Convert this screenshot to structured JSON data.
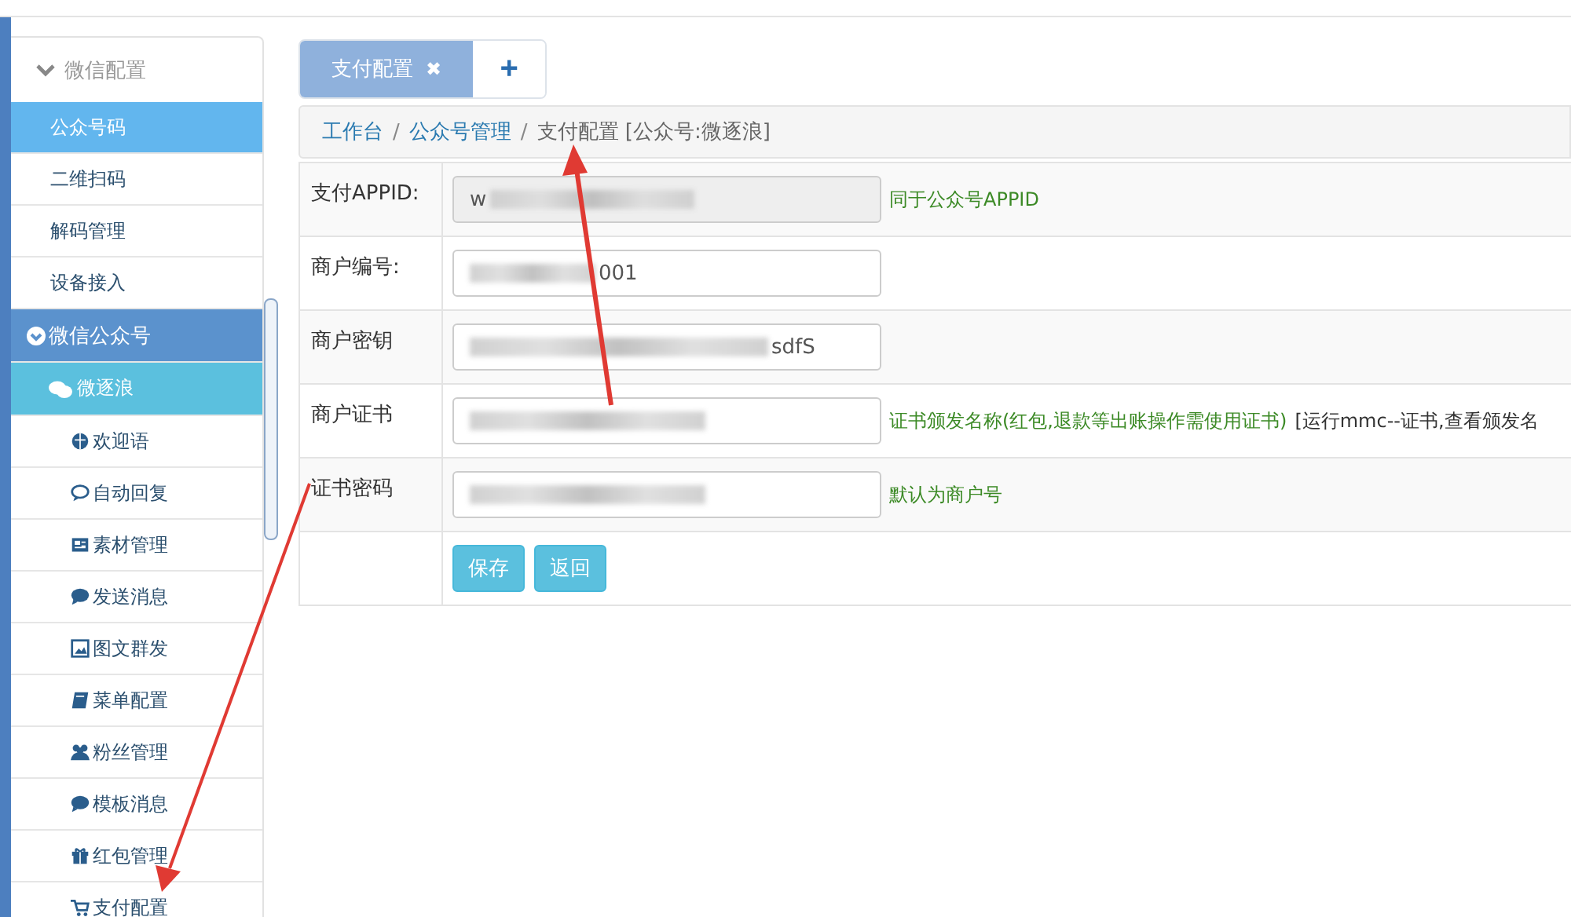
{
  "sidebar": {
    "group": {
      "label": "微信配置",
      "expanded": true
    },
    "items": [
      {
        "label": "公众号码",
        "selected": true
      },
      {
        "label": "二维扫码",
        "selected": false
      },
      {
        "label": "解码管理",
        "selected": false
      },
      {
        "label": "设备接入",
        "selected": false
      }
    ],
    "section": {
      "label": "微信公众号",
      "expanded": true
    },
    "account": {
      "label": "微逐浪",
      "children": [
        {
          "label": "欢迎语",
          "selected": false
        },
        {
          "label": "自动回复",
          "selected": false
        },
        {
          "label": "素材管理",
          "selected": false
        },
        {
          "label": "发送消息",
          "selected": false
        },
        {
          "label": "图文群发",
          "selected": false
        },
        {
          "label": "菜单配置",
          "selected": false
        },
        {
          "label": "粉丝管理",
          "selected": false
        },
        {
          "label": "模板消息",
          "selected": false
        },
        {
          "label": "红包管理",
          "selected": false
        },
        {
          "label": "支付配置",
          "selected": false
        }
      ]
    }
  },
  "tabs": [
    {
      "label": "支付配置",
      "selected": true,
      "close": "✖"
    }
  ],
  "add_tab": "+",
  "breadcrumb": {
    "separator": "/",
    "items": [
      {
        "label": "工作台",
        "link": true
      },
      {
        "label": "公众号管理",
        "link": true
      },
      {
        "label": "支付配置 [公众号:微逐浪]",
        "link": false
      }
    ]
  },
  "form": {
    "rows": [
      {
        "label": "支付APPID:",
        "value": "w",
        "redacted_before": false,
        "redacted_after": true,
        "disabled": true,
        "hint": "同于公众号APPID"
      },
      {
        "label": "商户编号:",
        "value": "001",
        "redacted_before": true,
        "redacted_after": false,
        "disabled": false
      },
      {
        "label": "商户密钥",
        "value": "sdfS",
        "redacted_before": true,
        "redacted_after": false,
        "disabled": false
      },
      {
        "label": "商户证书",
        "redacted_before": true,
        "redacted_after": false,
        "disabled": false,
        "hint": "证书颁发名称(红包,退款等出账操作需使用证书)",
        "note": "[运行mmc--证书,查看颁发名"
      },
      {
        "label": "证书密码",
        "redacted_before": true,
        "redacted_after": false,
        "disabled": false,
        "hint": "默认为商户号"
      }
    ],
    "buttons": [
      "保存",
      "返回"
    ]
  }
}
